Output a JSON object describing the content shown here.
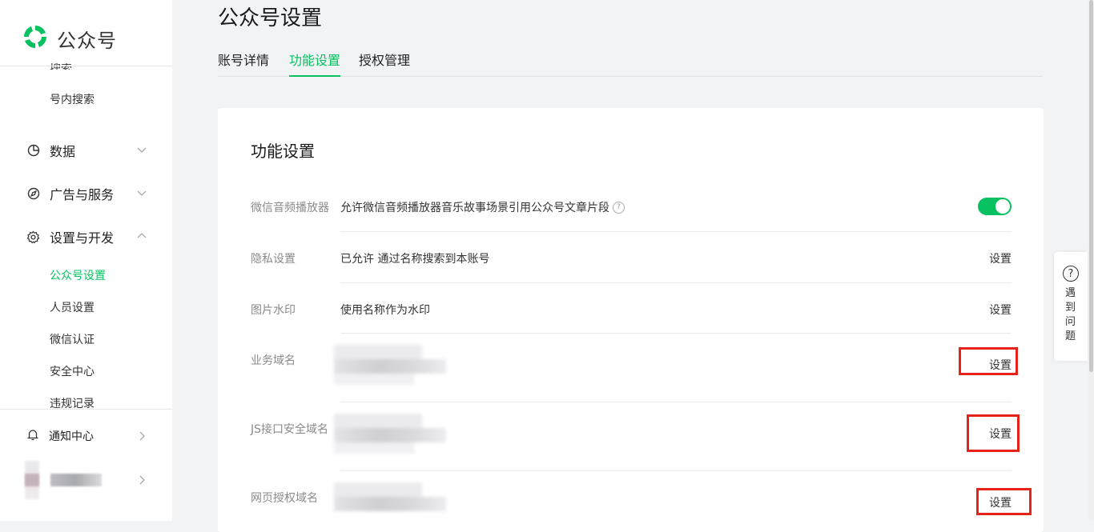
{
  "brand": {
    "name": "公众号",
    "color": "#07c160"
  },
  "sidebar": {
    "partial_item": "搜索",
    "search_item": "号内搜索",
    "groups": [
      {
        "label": "数据",
        "icon": "pie-chart-icon",
        "expanded": false
      },
      {
        "label": "广告与服务",
        "icon": "compass-icon",
        "expanded": false
      },
      {
        "label": "设置与开发",
        "icon": "gear-icon",
        "expanded": true
      }
    ],
    "settings_items": [
      {
        "label": "公众号设置",
        "active": true
      },
      {
        "label": "人员设置",
        "active": false
      },
      {
        "label": "微信认证",
        "active": false
      },
      {
        "label": "安全中心",
        "active": false
      },
      {
        "label": "违规记录",
        "active": false
      }
    ],
    "notification": {
      "label": "通知中心",
      "icon": "bell-icon"
    }
  },
  "page": {
    "title": "公众号设置",
    "tabs": [
      {
        "label": "账号详情",
        "active": false
      },
      {
        "label": "功能设置",
        "active": true
      },
      {
        "label": "授权管理",
        "active": false
      }
    ]
  },
  "card": {
    "title": "功能设置",
    "rows": [
      {
        "label": "微信音频播放器",
        "value": "允许微信音频播放器音乐故事场景引用公众号文章片段",
        "control": "toggle",
        "toggle_on": true
      },
      {
        "label": "隐私设置",
        "value": "已允许 通过名称搜索到本账号",
        "action": "设置"
      },
      {
        "label": "图片水印",
        "value": "使用名称作为水印",
        "action": "设置"
      },
      {
        "label": "业务域名",
        "value": "",
        "action": "设置",
        "value_blurred": true
      },
      {
        "label": "JS接口安全域名",
        "value": "",
        "action": "设置",
        "value_blurred": true
      },
      {
        "label": "网页授权域名",
        "value": "",
        "action": "设置",
        "value_blurred": true
      }
    ]
  },
  "help_widget": {
    "label": "遇到问题",
    "icon": "question-circle-icon"
  },
  "colors": {
    "accent": "#07c160",
    "highlight": "#e5231b"
  }
}
